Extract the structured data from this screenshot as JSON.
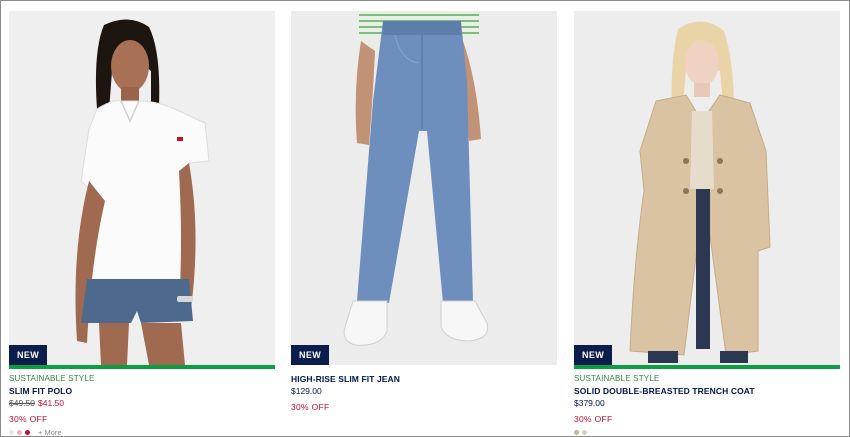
{
  "products": [
    {
      "badge": "NEW",
      "sustainable": "SUSTAINABLE STYLE",
      "name": "SLIM FIT POLO",
      "price_original": "$49.50",
      "price_sale": "$41.50",
      "discount": "30% OFF",
      "swatches": [
        "#e6e6e6",
        "#e8b4b8",
        "#c8102e"
      ],
      "more_label": "+ More"
    },
    {
      "badge": "NEW",
      "name": "HIGH-RISE SLIM FIT JEAN",
      "price": "$129.00",
      "discount": "30% OFF"
    },
    {
      "badge": "NEW",
      "sustainable": "SUSTAINABLE STYLE",
      "name": "SOLID DOUBLE-BREASTED TRENCH COAT",
      "price": "$379.00",
      "discount": "30% OFF",
      "swatches": [
        "#c9b392",
        "#d8cbb9"
      ]
    }
  ]
}
